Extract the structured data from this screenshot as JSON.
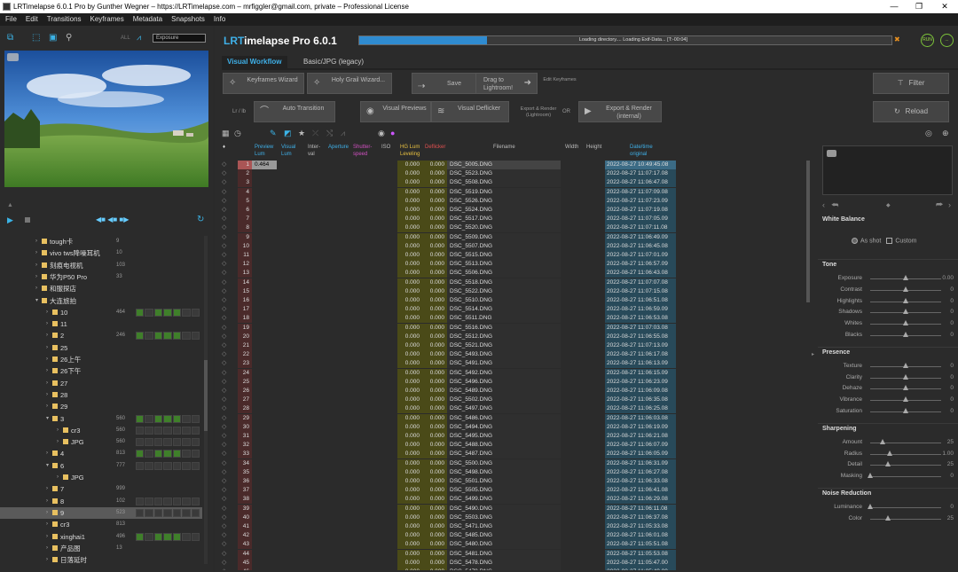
{
  "window": {
    "title": "LRTimelapse 6.0.1 Pro by Gunther Wegner – https://LRTimelapse.com – mrfiggler@gmail.com, private – Professional License",
    "controls": [
      "—",
      "❐",
      "✕"
    ]
  },
  "menu": [
    "File",
    "Edit",
    "Transitions",
    "Keyframes",
    "Metadata",
    "Snapshots",
    "Info"
  ],
  "left_panel": {
    "all_label": "ALL",
    "exposure_select": "Exposure",
    "tree": [
      {
        "depth": 1,
        "label": "tough卡",
        "count": "9",
        "boxes": 0
      },
      {
        "depth": 1,
        "label": "vivo tws降噪耳机",
        "count": "10",
        "boxes": 0
      },
      {
        "depth": 1,
        "label": "刻痕电视机",
        "count": "103",
        "boxes": 0
      },
      {
        "depth": 1,
        "label": "华为P50 Pro",
        "count": "33",
        "boxes": 0
      },
      {
        "depth": 1,
        "label": "和服探店",
        "count": "",
        "boxes": 0
      },
      {
        "depth": 1,
        "label": "大连旅拍",
        "count": "",
        "boxes": 0,
        "open": true
      },
      {
        "depth": 2,
        "label": "10",
        "count": "464",
        "boxes": 1
      },
      {
        "depth": 2,
        "label": "11",
        "count": "",
        "boxes": 0
      },
      {
        "depth": 2,
        "label": "2",
        "count": "246",
        "boxes": 1
      },
      {
        "depth": 2,
        "label": "25",
        "count": "",
        "boxes": 0
      },
      {
        "depth": 2,
        "label": "26上午",
        "count": "",
        "boxes": 0
      },
      {
        "depth": 2,
        "label": "26下午",
        "count": "",
        "boxes": 0
      },
      {
        "depth": 2,
        "label": "27",
        "count": "",
        "boxes": 0
      },
      {
        "depth": 2,
        "label": "28",
        "count": "",
        "boxes": 0
      },
      {
        "depth": 2,
        "label": "29",
        "count": "",
        "boxes": 0
      },
      {
        "depth": 2,
        "label": "3",
        "count": "560",
        "boxes": 1,
        "open": true
      },
      {
        "depth": 3,
        "label": "cr3",
        "count": "560",
        "boxes": 2
      },
      {
        "depth": 3,
        "label": "JPG",
        "count": "560",
        "boxes": 2
      },
      {
        "depth": 2,
        "label": "4",
        "count": "813",
        "boxes": 1
      },
      {
        "depth": 2,
        "label": "6",
        "count": "777",
        "boxes": 2,
        "open": true
      },
      {
        "depth": 3,
        "label": "JPG",
        "count": "",
        "boxes": 0
      },
      {
        "depth": 2,
        "label": "7",
        "count": "999",
        "boxes": 0
      },
      {
        "depth": 2,
        "label": "8",
        "count": "102",
        "boxes": 2
      },
      {
        "depth": 2,
        "label": "9",
        "count": "523",
        "boxes": 2,
        "selected": true
      },
      {
        "depth": 2,
        "label": "cr3",
        "count": "813",
        "boxes": 0
      },
      {
        "depth": 2,
        "label": "xinghai1",
        "count": "496",
        "boxes": 1
      },
      {
        "depth": 2,
        "label": "产品图",
        "count": "13",
        "boxes": 0
      },
      {
        "depth": 2,
        "label": "日落延时",
        "count": "",
        "boxes": 0
      }
    ]
  },
  "header": {
    "brand_prefix": "LRT",
    "brand_rest": "imelapse Pro 6.0.1",
    "progress": 0.24,
    "progress_text": "Loading directory.... Loading Exif-Data... [T:-00:04]",
    "close_label": "✖",
    "badge_1": "RUN",
    "badge_2": "..."
  },
  "tabs": [
    "Visual Workflow",
    "Basic/JPG (legacy)"
  ],
  "workflow": {
    "keyframes_wizard": "Keyframes Wizard",
    "holy_grail_wizard": "Holy Grail Wizard...",
    "save": "Save",
    "drag_to_lr": "Drag to Lightroom!",
    "edit_keyframes": "Edit Keyframes",
    "filter": "Filter",
    "lr_label": "Lr / lb",
    "auto_transition": "Auto Transition",
    "visual_previews": "Visual Previews",
    "visual_deflicker": "Visual Deflicker",
    "export_render_lr": "Export & Render (Lightroom)",
    "or": "OR",
    "export_render_internal": "Export & Render (internal)",
    "reload": "Reload"
  },
  "table": {
    "headers": {
      "mark": "♦",
      "preview_lum": "Preview Lum",
      "visual_lum": "Visual Lum",
      "interval": "Inter- val",
      "aperture": "Aperture",
      "shutter": "Shutter- speed",
      "iso": "ISO",
      "hg_lum": "HG Lum Leveling",
      "deflicker": "Deflicker",
      "filename": "Filename",
      "width": "Width",
      "height": "Height",
      "datetime": "Date/time original"
    },
    "rows": [
      {
        "n": "1",
        "prev": "0.464",
        "hg": "0.000",
        "def": "0.000",
        "fn": "DSC_5005.DNG",
        "dt": "2022-08-27 10:49:45.08"
      },
      {
        "n": "2",
        "prev": "",
        "hg": "0.000",
        "def": "0.000",
        "fn": "DSC_5523.DNG",
        "dt": "2022-08-27 11:07:17.08"
      },
      {
        "n": "3",
        "prev": "",
        "hg": "0.000",
        "def": "0.000",
        "fn": "DSC_5508.DNG",
        "dt": "2022-08-27 11:06:47.08"
      },
      {
        "n": "4",
        "prev": "",
        "hg": "0.000",
        "def": "0.000",
        "fn": "DSC_5519.DNG",
        "dt": "2022-08-27 11:07:09.08"
      },
      {
        "n": "5",
        "prev": "",
        "hg": "0.000",
        "def": "0.000",
        "fn": "DSC_5526.DNG",
        "dt": "2022-08-27 11:07:23.09"
      },
      {
        "n": "6",
        "prev": "",
        "hg": "0.000",
        "def": "0.000",
        "fn": "DSC_5524.DNG",
        "dt": "2022-08-27 11:07:19.08"
      },
      {
        "n": "7",
        "prev": "",
        "hg": "0.000",
        "def": "0.000",
        "fn": "DSC_5517.DNG",
        "dt": "2022-08-27 11:07:05.09"
      },
      {
        "n": "8",
        "prev": "",
        "hg": "0.000",
        "def": "0.000",
        "fn": "DSC_5520.DNG",
        "dt": "2022-08-27 11:07:11.08"
      },
      {
        "n": "9",
        "prev": "",
        "hg": "0.000",
        "def": "0.000",
        "fn": "DSC_5509.DNG",
        "dt": "2022-08-27 11:06:49.09"
      },
      {
        "n": "10",
        "prev": "",
        "hg": "0.000",
        "def": "0.000",
        "fn": "DSC_5507.DNG",
        "dt": "2022-08-27 11:06:45.08"
      },
      {
        "n": "11",
        "prev": "",
        "hg": "0.000",
        "def": "0.000",
        "fn": "DSC_5515.DNG",
        "dt": "2022-08-27 11:07:01.09"
      },
      {
        "n": "12",
        "prev": "",
        "hg": "0.000",
        "def": "0.000",
        "fn": "DSC_5513.DNG",
        "dt": "2022-08-27 11:06:57.09"
      },
      {
        "n": "13",
        "prev": "",
        "hg": "0.000",
        "def": "0.000",
        "fn": "DSC_5506.DNG",
        "dt": "2022-08-27 11:06:43.08"
      },
      {
        "n": "14",
        "prev": "",
        "hg": "0.000",
        "def": "0.000",
        "fn": "DSC_5518.DNG",
        "dt": "2022-08-27 11:07:07.08"
      },
      {
        "n": "15",
        "prev": "",
        "hg": "0.000",
        "def": "0.000",
        "fn": "DSC_5522.DNG",
        "dt": "2022-08-27 11:07:15.08"
      },
      {
        "n": "16",
        "prev": "",
        "hg": "0.000",
        "def": "0.000",
        "fn": "DSC_5510.DNG",
        "dt": "2022-08-27 11:06:51.08"
      },
      {
        "n": "17",
        "prev": "",
        "hg": "0.000",
        "def": "0.000",
        "fn": "DSC_5514.DNG",
        "dt": "2022-08-27 11:06:59.09"
      },
      {
        "n": "18",
        "prev": "",
        "hg": "0.000",
        "def": "0.000",
        "fn": "DSC_5511.DNG",
        "dt": "2022-08-27 11:06:53.08"
      },
      {
        "n": "19",
        "prev": "",
        "hg": "0.000",
        "def": "0.000",
        "fn": "DSC_5516.DNG",
        "dt": "2022-08-27 11:07:03.08"
      },
      {
        "n": "20",
        "prev": "",
        "hg": "0.000",
        "def": "0.000",
        "fn": "DSC_5512.DNG",
        "dt": "2022-08-27 11:06:55.08"
      },
      {
        "n": "21",
        "prev": "",
        "hg": "0.000",
        "def": "0.000",
        "fn": "DSC_5521.DNG",
        "dt": "2022-08-27 11:07:13.09"
      },
      {
        "n": "22",
        "prev": "",
        "hg": "0.000",
        "def": "0.000",
        "fn": "DSC_5493.DNG",
        "dt": "2022-08-27 11:06:17.08"
      },
      {
        "n": "23",
        "prev": "",
        "hg": "0.000",
        "def": "0.000",
        "fn": "DSC_5491.DNG",
        "dt": "2022-08-27 11:06:13.09"
      },
      {
        "n": "24",
        "prev": "",
        "hg": "0.000",
        "def": "0.000",
        "fn": "DSC_5492.DNG",
        "dt": "2022-08-27 11:06:15.09"
      },
      {
        "n": "25",
        "prev": "",
        "hg": "0.000",
        "def": "0.000",
        "fn": "DSC_5496.DNG",
        "dt": "2022-08-27 11:06:23.09"
      },
      {
        "n": "26",
        "prev": "",
        "hg": "0.000",
        "def": "0.000",
        "fn": "DSC_5489.DNG",
        "dt": "2022-08-27 11:06:09.08"
      },
      {
        "n": "27",
        "prev": "",
        "hg": "0.000",
        "def": "0.000",
        "fn": "DSC_5502.DNG",
        "dt": "2022-08-27 11:06:35.08"
      },
      {
        "n": "28",
        "prev": "",
        "hg": "0.000",
        "def": "0.000",
        "fn": "DSC_5497.DNG",
        "dt": "2022-08-27 11:06:25.08"
      },
      {
        "n": "29",
        "prev": "",
        "hg": "0.000",
        "def": "0.000",
        "fn": "DSC_5486.DNG",
        "dt": "2022-08-27 11:06:03.08"
      },
      {
        "n": "30",
        "prev": "",
        "hg": "0.000",
        "def": "0.000",
        "fn": "DSC_5494.DNG",
        "dt": "2022-08-27 11:06:19.09"
      },
      {
        "n": "31",
        "prev": "",
        "hg": "0.000",
        "def": "0.000",
        "fn": "DSC_5495.DNG",
        "dt": "2022-08-27 11:06:21.08"
      },
      {
        "n": "32",
        "prev": "",
        "hg": "0.000",
        "def": "0.000",
        "fn": "DSC_5488.DNG",
        "dt": "2022-08-27 11:06:07.09"
      },
      {
        "n": "33",
        "prev": "",
        "hg": "0.000",
        "def": "0.000",
        "fn": "DSC_5487.DNG",
        "dt": "2022-08-27 11:06:05.09"
      },
      {
        "n": "34",
        "prev": "",
        "hg": "0.000",
        "def": "0.000",
        "fn": "DSC_5500.DNG",
        "dt": "2022-08-27 11:06:31.09"
      },
      {
        "n": "35",
        "prev": "",
        "hg": "0.000",
        "def": "0.000",
        "fn": "DSC_5498.DNG",
        "dt": "2022-08-27 11:06:27.08"
      },
      {
        "n": "36",
        "prev": "",
        "hg": "0.000",
        "def": "0.000",
        "fn": "DSC_5501.DNG",
        "dt": "2022-08-27 11:06:33.08"
      },
      {
        "n": "37",
        "prev": "",
        "hg": "0.000",
        "def": "0.000",
        "fn": "DSC_5505.DNG",
        "dt": "2022-08-27 11:06:41.08"
      },
      {
        "n": "38",
        "prev": "",
        "hg": "0.000",
        "def": "0.000",
        "fn": "DSC_5499.DNG",
        "dt": "2022-08-27 11:06:29.08"
      },
      {
        "n": "39",
        "prev": "",
        "hg": "0.000",
        "def": "0.000",
        "fn": "DSC_5490.DNG",
        "dt": "2022-08-27 11:06:11.08"
      },
      {
        "n": "40",
        "prev": "",
        "hg": "0.000",
        "def": "0.000",
        "fn": "DSC_5503.DNG",
        "dt": "2022-08-27 11:06:37.08"
      },
      {
        "n": "41",
        "prev": "",
        "hg": "0.000",
        "def": "0.000",
        "fn": "DSC_5471.DNG",
        "dt": "2022-08-27 11:05:33.08"
      },
      {
        "n": "42",
        "prev": "",
        "hg": "0.000",
        "def": "0.000",
        "fn": "DSC_5485.DNG",
        "dt": "2022-08-27 11:06:01.08"
      },
      {
        "n": "43",
        "prev": "",
        "hg": "0.000",
        "def": "0.000",
        "fn": "DSC_5480.DNG",
        "dt": "2022-08-27 11:05:51.08"
      },
      {
        "n": "44",
        "prev": "",
        "hg": "0.000",
        "def": "0.000",
        "fn": "DSC_5481.DNG",
        "dt": "2022-08-27 11:05:53.08"
      },
      {
        "n": "45",
        "prev": "",
        "hg": "0.000",
        "def": "0.000",
        "fn": "DSC_5478.DNG",
        "dt": "2022-08-27 11:05:47.00"
      },
      {
        "n": "46",
        "prev": "",
        "hg": "0.000",
        "def": "0.000",
        "fn": "DSC_5479.DNG",
        "dt": "2022-08-27 11:05:49.09"
      }
    ]
  },
  "right_panel": {
    "white_balance": "White Balance",
    "as_shot": "As shot",
    "custom": "Custom",
    "sections": [
      {
        "title": "Tone",
        "sliders": [
          {
            "label": "Exposure",
            "value": "0.00",
            "pos": 0.5
          },
          {
            "label": "Contrast",
            "value": "0",
            "pos": 0.5
          },
          {
            "label": "Highlights",
            "value": "0",
            "pos": 0.5
          },
          {
            "label": "Shadows",
            "value": "0",
            "pos": 0.5
          },
          {
            "label": "Whites",
            "value": "0",
            "pos": 0.5
          },
          {
            "label": "Blacks",
            "value": "0",
            "pos": 0.5
          }
        ]
      },
      {
        "title": "Presence",
        "sliders": [
          {
            "label": "Texture",
            "value": "0",
            "pos": 0.5
          },
          {
            "label": "Clarity",
            "value": "0",
            "pos": 0.5
          },
          {
            "label": "Dehaze",
            "value": "0",
            "pos": 0.5
          },
          {
            "label": "Vibrance",
            "value": "0",
            "pos": 0.5
          },
          {
            "label": "Saturation",
            "value": "0",
            "pos": 0.5
          }
        ]
      },
      {
        "title": "Sharpening",
        "sliders": [
          {
            "label": "Amount",
            "value": "25",
            "pos": 0.17
          },
          {
            "label": "Radius",
            "value": "1.00",
            "pos": 0.27
          },
          {
            "label": "Detail",
            "value": "25",
            "pos": 0.25
          },
          {
            "label": "Masking",
            "value": "0",
            "pos": 0.0
          }
        ]
      },
      {
        "title": "Noise Reduction",
        "sliders": [
          {
            "label": "Luminance",
            "value": "0",
            "pos": 0.0
          },
          {
            "label": "Color",
            "value": "25",
            "pos": 0.25
          }
        ]
      }
    ]
  }
}
